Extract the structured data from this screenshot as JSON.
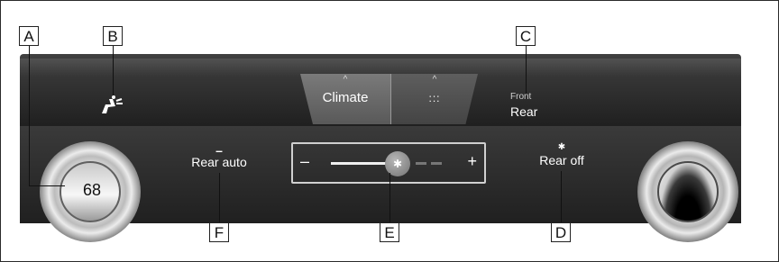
{
  "callouts": {
    "a": "A",
    "b": "B",
    "c": "C",
    "d": "D",
    "e": "E",
    "f": "F"
  },
  "tabs": {
    "climate_caret": "^",
    "climate_label": "Climate",
    "menu_caret": "^",
    "menu_icon": ":::"
  },
  "zone": {
    "front_label": "Front",
    "rear_label": "Rear"
  },
  "temperature": {
    "value": "68"
  },
  "buttons": {
    "rear_auto_indicator": "–",
    "rear_auto_label": "Rear auto",
    "rear_off_icon": "✱",
    "rear_off_label": "Rear off"
  },
  "fan_slider": {
    "minus": "–",
    "plus": "+",
    "thumb_icon": "✱",
    "level_fraction": 0.5
  },
  "icons": {
    "seat_airflow": "seat-airflow-icon",
    "fan": "fan-icon"
  }
}
